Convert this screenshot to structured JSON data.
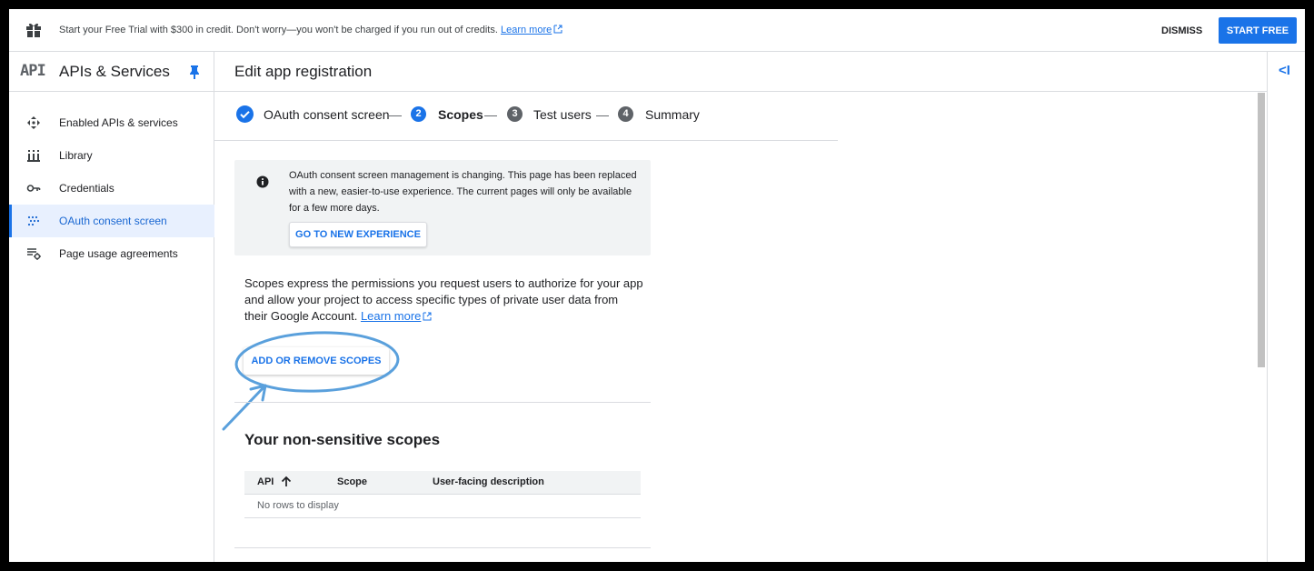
{
  "banner": {
    "text": "Start your Free Trial with $300 in credit. Don't worry—you won't be charged if you run out of credits.",
    "learn_more": "Learn more",
    "dismiss": "DISMISS",
    "start_free": "START FREE",
    "icon": "gift-icon"
  },
  "sidebar": {
    "logo": "API",
    "title": "APIs & Services",
    "items": [
      {
        "label": "Enabled APIs & services",
        "icon": "enabled-apis-icon"
      },
      {
        "label": "Library",
        "icon": "library-icon"
      },
      {
        "label": "Credentials",
        "icon": "key-icon"
      },
      {
        "label": "OAuth consent screen",
        "icon": "consent-icon",
        "active": true
      },
      {
        "label": "Page usage agreements",
        "icon": "agreements-icon"
      }
    ],
    "collapse": "<I"
  },
  "header": {
    "title": "Edit app registration"
  },
  "stepper": {
    "steps": [
      {
        "label": "OAuth consent screen",
        "state": "done"
      },
      {
        "number": "2",
        "label": "Scopes",
        "state": "active"
      },
      {
        "number": "3",
        "label": "Test users",
        "state": "pending"
      },
      {
        "number": "4",
        "label": "Summary",
        "state": "pending"
      }
    ],
    "dash": "—"
  },
  "info": {
    "text": "OAuth consent screen management is changing. This page has been replaced with a new, easier-to-use experience. The current pages will only be available for a few more days.",
    "button": "GO TO NEW EXPERIENCE"
  },
  "description": {
    "text": "Scopes express the permissions you request users to authorize for your app and allow your project to access specific types of private user data from their Google Account.",
    "learn_more": "Learn more"
  },
  "scopes_button": "ADD OR REMOVE SCOPES",
  "non_sensitive": {
    "title": "Your non-sensitive scopes",
    "columns": [
      "API",
      "Scope",
      "User-facing description"
    ],
    "empty": "No rows to display"
  },
  "rail": {
    "collapse": "<I"
  },
  "colors": {
    "accent": "#1a73e8",
    "annotation": "#5aa0dc",
    "active_bg": "#e8f0fe"
  }
}
